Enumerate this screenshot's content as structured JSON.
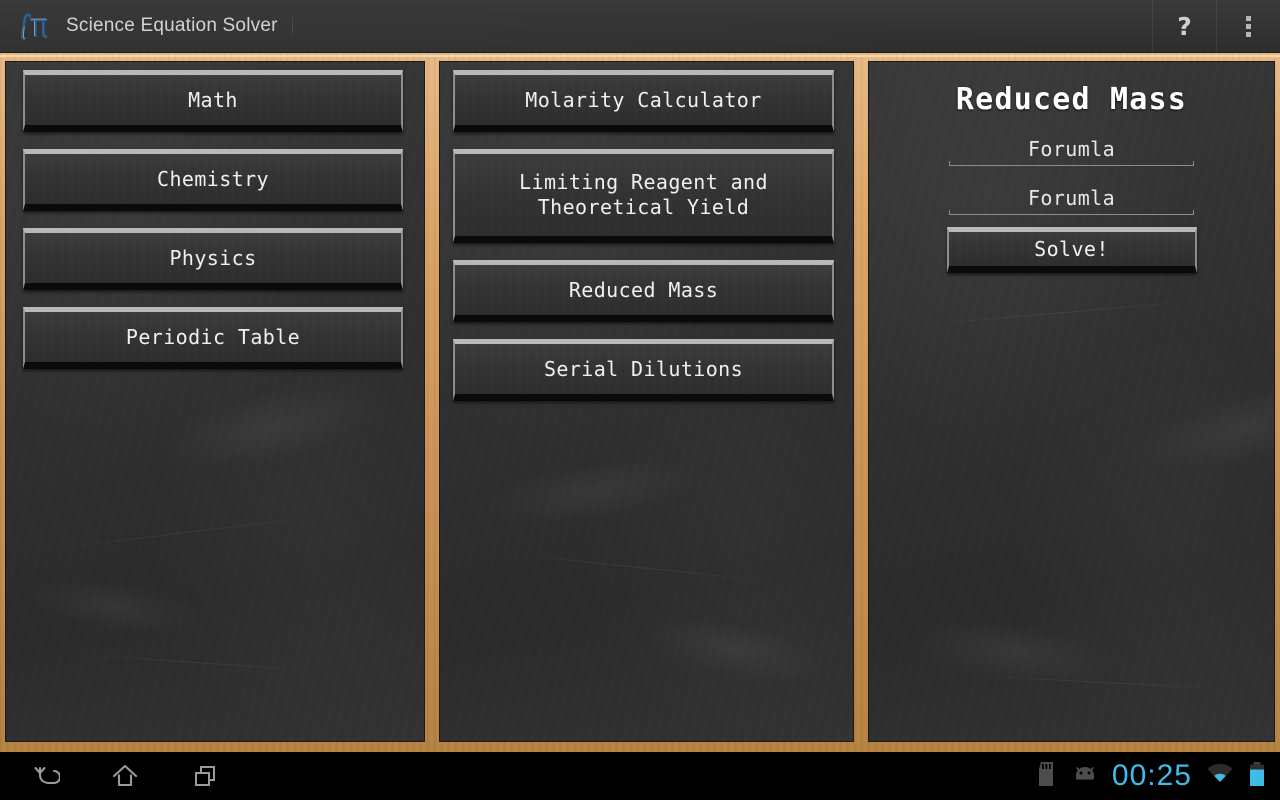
{
  "titlebar": {
    "app_name": "Science Equation Solver",
    "logo_icon": "integral-pi-logo",
    "help_label": "?",
    "help_icon": "help-question-icon",
    "overflow_icon": "overflow-menu-icon"
  },
  "categories": {
    "panel_name": "categories",
    "items": [
      {
        "label": "Math"
      },
      {
        "label": "Chemistry"
      },
      {
        "label": "Physics"
      },
      {
        "label": "Periodic Table"
      }
    ]
  },
  "tools": {
    "panel_name": "chemistry-tools",
    "items": [
      {
        "label": "Molarity Calculator"
      },
      {
        "label": "Limiting Reagent and\nTheoretical Yield"
      },
      {
        "label": "Reduced Mass"
      },
      {
        "label": "Serial Dilutions"
      }
    ]
  },
  "solver": {
    "title": "Reduced Mass",
    "fields": [
      {
        "value": "Forumla",
        "placeholder": "Forumla"
      },
      {
        "value": "Forumla",
        "placeholder": "Forumla"
      }
    ],
    "solve_label": "Solve!"
  },
  "navbar": {
    "back_icon": "back-arrow-icon",
    "home_icon": "home-icon",
    "recents_icon": "recent-apps-icon",
    "sdcard_icon": "sd-card-icon",
    "android_icon": "android-head-icon",
    "time": "00:25",
    "wifi_icon": "wifi-icon",
    "battery_icon": "battery-icon"
  },
  "colors": {
    "accent": "#3fbbe8",
    "wood": "#d9a364",
    "board": "#313131",
    "button_top_bevel": "#b9b9b9",
    "text": "#f0f0f0"
  }
}
